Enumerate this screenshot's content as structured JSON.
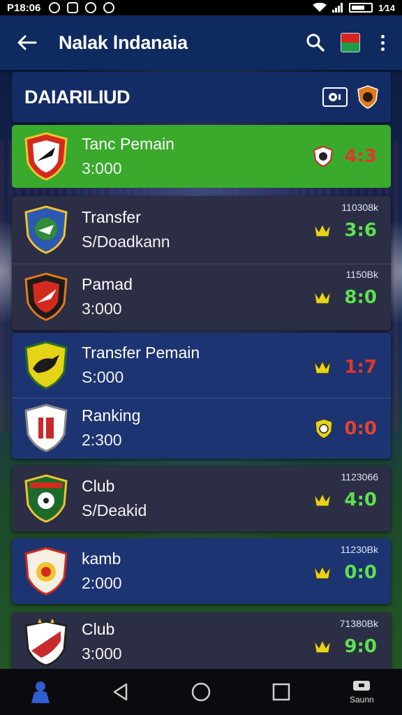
{
  "status_bar": {
    "time": "P18:06",
    "battery_text": "1⁄14"
  },
  "app_bar": {
    "title": "Nalak lndanaia"
  },
  "section": {
    "title": "DAIARILIUD"
  },
  "rows": [
    {
      "name": "Tanc Pemain",
      "sub": "3:000",
      "meta": "",
      "score": "4:3",
      "score_color": "#e2362b",
      "badge_colors": [
        "#d42a1e",
        "#ffffff"
      ]
    },
    {
      "name": "Transfer",
      "sub": "S/Doadkann",
      "meta": "110308k",
      "score": "3:6",
      "score_color": "#5fe04e",
      "badge_colors": [
        "#2d59b0",
        "#2f8c3a"
      ]
    },
    {
      "name": "Pamad",
      "sub": "3:000",
      "meta": "1150Bk",
      "score": "8:0",
      "score_color": "#5fe04e",
      "badge_colors": [
        "#1b1b1b",
        "#d42a1e"
      ]
    },
    {
      "name": "Transfer Pemain",
      "sub": "S:000",
      "meta": "",
      "score": "1:7",
      "score_color": "#e2362b",
      "badge_colors": [
        "#e5d316",
        "#2d6e2a"
      ]
    },
    {
      "name": "Ranking",
      "sub": "2:300",
      "meta": "",
      "score": "0:0",
      "score_color": "#e0452d",
      "badge_colors": [
        "#ffffff",
        "#c92a2a"
      ]
    },
    {
      "name": "Club",
      "sub": "S/Deakid",
      "meta": "1123066",
      "score": "4:0",
      "score_color": "#5fe04e",
      "badge_colors": [
        "#1d6b2b",
        "#d42a1e"
      ]
    },
    {
      "name": "kamb",
      "sub": "2:000",
      "meta": "11230Bk",
      "score": "0:0",
      "score_color": "#5fe04e",
      "badge_colors": [
        "#f4f0e2",
        "#d42a1e"
      ]
    },
    {
      "name": "Club",
      "sub": "3:000",
      "meta": "71380Bk",
      "score": "9:0",
      "score_color": "#5fe04e",
      "badge_colors": [
        "#ffffff",
        "#c92a2a"
      ]
    }
  ],
  "nav": {
    "right_label": "Saunn"
  },
  "colors": {
    "highlight": "#3aaa2c",
    "app_bar": "#0f2a5f",
    "panel_blue": "#1d3472",
    "panel_dark": "#2b2e44"
  }
}
